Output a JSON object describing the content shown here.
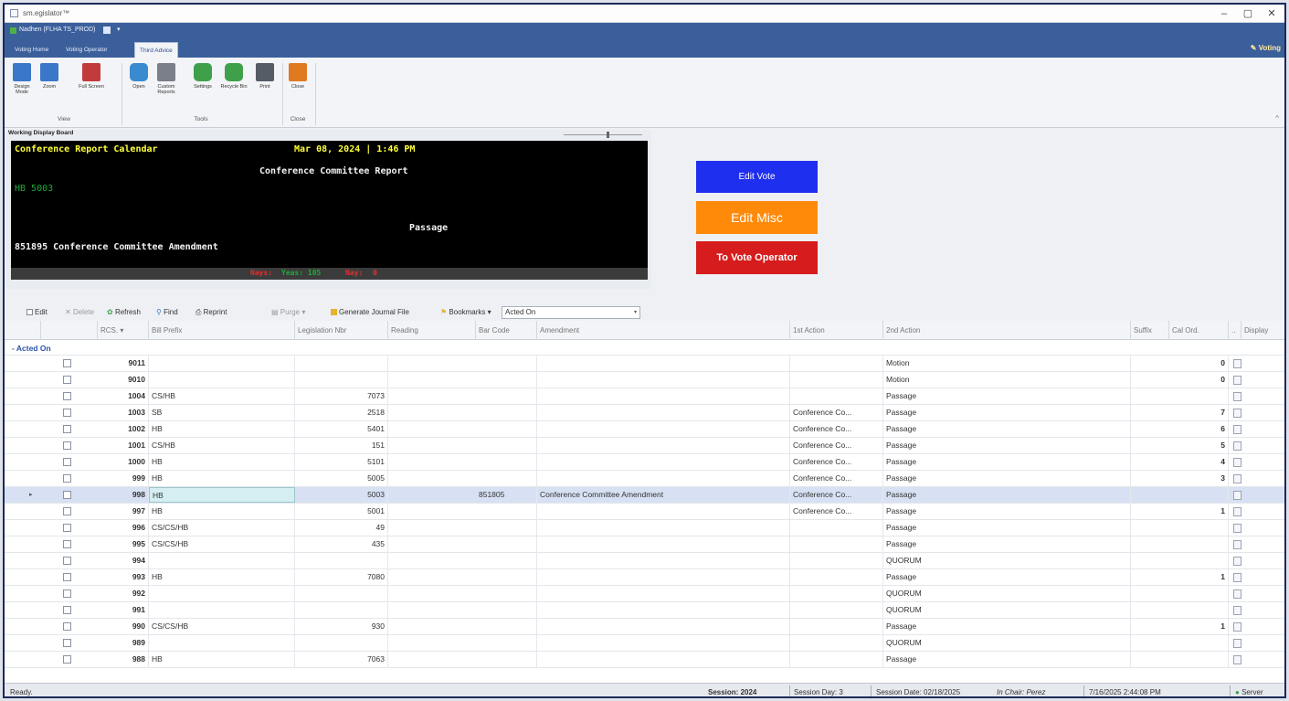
{
  "window": {
    "title": "sm.egislator™",
    "min": "–",
    "max": "▢",
    "close": "✕"
  },
  "quick_access": {
    "user": "Nadhen (FLHA TS_PROD)",
    "arrow": "▾"
  },
  "tabs": [
    {
      "label": "Voting Home"
    },
    {
      "label": "Voting Operator"
    },
    {
      "label": "Third Advice"
    }
  ],
  "voting_link": "Voting",
  "ribbon": {
    "buttons": [
      {
        "label": "Design Mode",
        "icon": "design-mode-icon",
        "color": "#3a77c9"
      },
      {
        "label": "Zoom",
        "icon": "zoom-icon",
        "color": "#3a77c9"
      },
      {
        "label": "Full Screen",
        "icon": "fullscreen-icon",
        "color": "#c23b3b"
      },
      {
        "label": "Open",
        "icon": "folder-icon",
        "color": "#3a8ad0"
      },
      {
        "label": "Custom Reports",
        "icon": "report-icon",
        "color": "#7a7f8a"
      },
      {
        "label": "Settings",
        "icon": "settings-icon",
        "color": "#3fa04a"
      },
      {
        "label": "Recycle Bin",
        "icon": "recycle-icon",
        "color": "#3fa04a"
      },
      {
        "label": "Print",
        "icon": "print-icon",
        "color": "#555c66"
      },
      {
        "label": "Close",
        "icon": "close-icon",
        "color": "#e07a20"
      }
    ],
    "groups": [
      "View",
      "Tools",
      "Close"
    ]
  },
  "board": {
    "title": "Working Display Board",
    "line1_left": "Conference Report Calendar",
    "line1_right": "Mar 08, 2024 | 1:46 PM",
    "line2": "Conference Committee Report",
    "bill": "HB 5003",
    "action": "Passage",
    "amendment": "851895 Conference Committee Amendment",
    "status_a": "Nays:",
    "status_b": "Yeas: 105",
    "status_c": "Nay:",
    "status_d": "0",
    "colors": {
      "yellow": "#ffff3a",
      "white": "#f2f2f2",
      "green": "#1fa83a",
      "red": "#e23030"
    }
  },
  "buttons": {
    "edit_vote": "Edit Vote",
    "edit_misc": "Edit Misc",
    "to_vote_operator": "To Vote Operator",
    "colors": {
      "blue": "#1f2ff0",
      "orange": "#ff8a0a",
      "red": "#d61c1c"
    }
  },
  "grid_toolbar": {
    "edit": "Edit",
    "delete": "Delete",
    "refresh": "Refresh",
    "find": "Find",
    "reprint": "Reprint",
    "purge": "Purge",
    "generate": "Generate Journal File",
    "bookmarks": "Bookmarks",
    "filter_value": "Acted On"
  },
  "grid": {
    "columns": [
      "RCS.",
      "Bill Prefix",
      "Legislation Nbr",
      "Reading",
      "Bar Code",
      "Amendment",
      "1st Action",
      "2nd Action",
      "Suffix",
      "Cal Ord.",
      "..",
      "Display"
    ],
    "group_label": "- Acted On",
    "rows": [
      {
        "rcs": "9011",
        "prefix": "",
        "nbr": "",
        "bar": "",
        "amend": "",
        "first": "",
        "second": "Motion",
        "cal": "0"
      },
      {
        "rcs": "9010",
        "prefix": "",
        "nbr": "",
        "bar": "",
        "amend": "",
        "first": "",
        "second": "Motion",
        "cal": "0"
      },
      {
        "rcs": "1004",
        "prefix": "CS/HB",
        "nbr": "7073",
        "bar": "",
        "amend": "",
        "first": "",
        "second": "Passage",
        "cal": ""
      },
      {
        "rcs": "1003",
        "prefix": "SB",
        "nbr": "2518",
        "bar": "",
        "amend": "",
        "first": "Conference Co...",
        "second": "Passage",
        "cal": "7"
      },
      {
        "rcs": "1002",
        "prefix": "HB",
        "nbr": "5401",
        "bar": "",
        "amend": "",
        "first": "Conference Co...",
        "second": "Passage",
        "cal": "6"
      },
      {
        "rcs": "1001",
        "prefix": "CS/HB",
        "nbr": "151",
        "bar": "",
        "amend": "",
        "first": "Conference Co...",
        "second": "Passage",
        "cal": "5"
      },
      {
        "rcs": "1000",
        "prefix": "HB",
        "nbr": "5101",
        "bar": "",
        "amend": "",
        "first": "Conference Co...",
        "second": "Passage",
        "cal": "4"
      },
      {
        "rcs": "999",
        "prefix": "HB",
        "nbr": "5005",
        "bar": "",
        "amend": "",
        "first": "Conference Co...",
        "second": "Passage",
        "cal": "3"
      },
      {
        "rcs": "998",
        "prefix": "HB",
        "nbr": "5003",
        "bar": "851805",
        "amend": "Conference Committee Amendment",
        "first": "Conference Co...",
        "second": "Passage",
        "cal": "",
        "selected": true
      },
      {
        "rcs": "997",
        "prefix": "HB",
        "nbr": "5001",
        "bar": "",
        "amend": "",
        "first": "Conference Co...",
        "second": "Passage",
        "cal": "1"
      },
      {
        "rcs": "996",
        "prefix": "CS/CS/HB",
        "nbr": "49",
        "bar": "",
        "amend": "",
        "first": "",
        "second": "Passage",
        "cal": ""
      },
      {
        "rcs": "995",
        "prefix": "CS/CS/HB",
        "nbr": "435",
        "bar": "",
        "amend": "",
        "first": "",
        "second": "Passage",
        "cal": ""
      },
      {
        "rcs": "994",
        "prefix": "",
        "nbr": "",
        "bar": "",
        "amend": "",
        "first": "",
        "second": "QUORUM",
        "cal": ""
      },
      {
        "rcs": "993",
        "prefix": "HB",
        "nbr": "7080",
        "bar": "",
        "amend": "",
        "first": "",
        "second": "Passage",
        "cal": "1"
      },
      {
        "rcs": "992",
        "prefix": "",
        "nbr": "",
        "bar": "",
        "amend": "",
        "first": "",
        "second": "QUORUM",
        "cal": ""
      },
      {
        "rcs": "991",
        "prefix": "",
        "nbr": "",
        "bar": "",
        "amend": "",
        "first": "",
        "second": "QUORUM",
        "cal": ""
      },
      {
        "rcs": "990",
        "prefix": "CS/CS/HB",
        "nbr": "930",
        "bar": "",
        "amend": "",
        "first": "",
        "second": "Passage",
        "cal": "1"
      },
      {
        "rcs": "989",
        "prefix": "",
        "nbr": "",
        "bar": "",
        "amend": "",
        "first": "",
        "second": "QUORUM",
        "cal": ""
      },
      {
        "rcs": "988",
        "prefix": "HB",
        "nbr": "7063",
        "bar": "",
        "amend": "",
        "first": "",
        "second": "Passage",
        "cal": ""
      }
    ]
  },
  "statusbar": {
    "ready": "Ready.",
    "session": "Session: 2024",
    "session_day": "Session Day: 3",
    "session_date": "Session Date: 02/18/2025",
    "in_chair": "In Chair: Perez",
    "datetime": "7/16/2025 2:44:08 PM",
    "server": "Server"
  }
}
